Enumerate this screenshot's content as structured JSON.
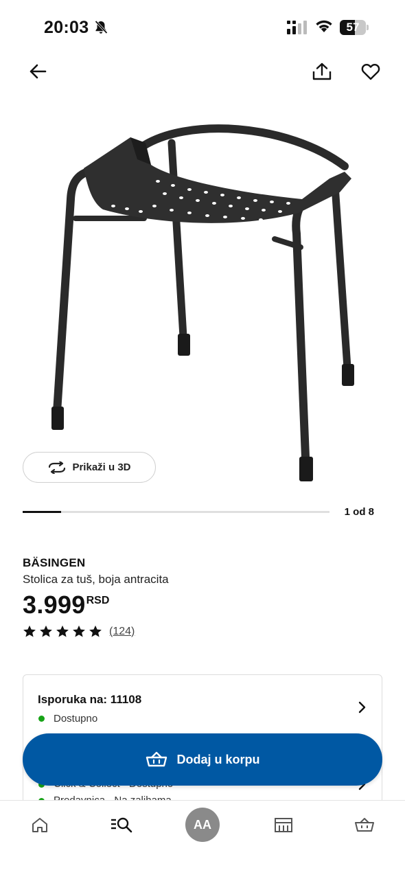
{
  "status_bar": {
    "time": "20:03",
    "battery": "57",
    "battery_level": 0.57
  },
  "icons": {
    "bell": "bell-muted-icon",
    "signal": "signal-icon",
    "wifi": "wifi-icon",
    "back": "arrow-left-icon",
    "share": "share-icon",
    "favorite": "heart-icon",
    "rotate": "rotate-3d-icon",
    "cart": "shopping-basket-icon",
    "chevron": "chevron-right-icon"
  },
  "gallery": {
    "view_3d_label": "Prikaži u 3D",
    "counter": "1 od 8",
    "current": 1,
    "total": 8
  },
  "product": {
    "name": "BÄSINGEN",
    "description": "Stolica za tuš, boja antracita",
    "price": "3.999",
    "currency": "RSD",
    "rating": 5,
    "review_count": "(124)"
  },
  "availability": {
    "delivery_title": "Isporuka na: 11108",
    "delivery_status": "Dostupno",
    "row2_text": "Click & Collect - Dostupno",
    "row3_text": "Prodavnica - Na zalihama",
    "status_color": "#17a317"
  },
  "cart": {
    "label": "Dodaj u korpu",
    "color": "#0058a3"
  },
  "bottom_nav": {
    "avatar_initials": "AA",
    "items": [
      "home-icon",
      "search-list-icon",
      "avatar",
      "store-icon",
      "basket-icon"
    ]
  }
}
